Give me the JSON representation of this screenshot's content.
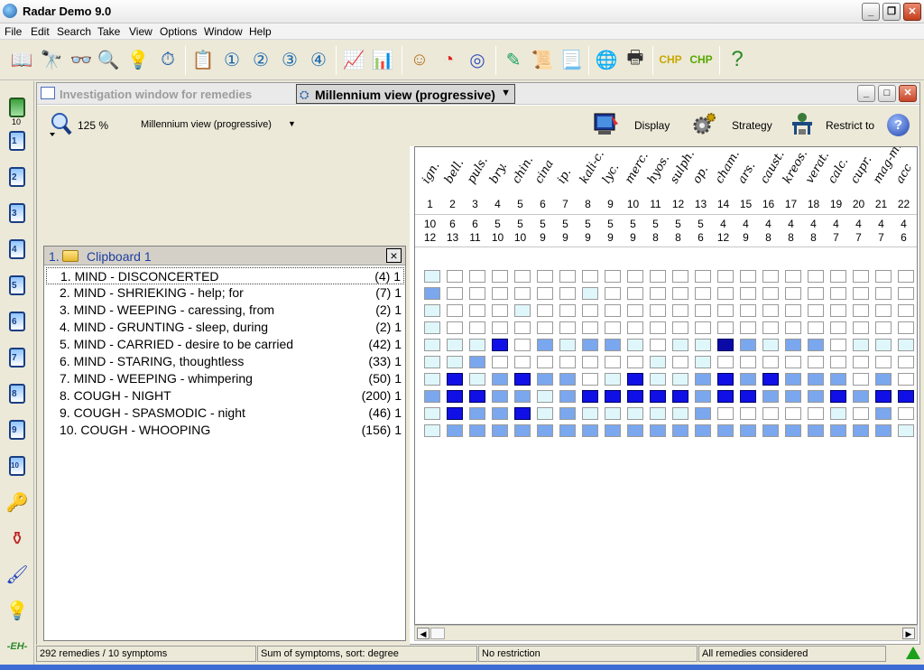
{
  "app": {
    "title": "Radar Demo 9.0"
  },
  "menu": [
    "File",
    "Edit",
    "Search",
    "Take",
    "View",
    "Options",
    "Window",
    "Help"
  ],
  "left_sidebar": {
    "counter": "10",
    "clipboards": [
      "1",
      "2",
      "3",
      "4",
      "5",
      "6",
      "7",
      "8",
      "9",
      "10"
    ]
  },
  "window": {
    "title": "Investigation window for remedies",
    "view_selector": "Millennium view (progressive)",
    "zoom": "125 %",
    "view_name": "Millennium view (progressive)",
    "display_label": "Display",
    "strategy_label": "Strategy",
    "restrict_label": "Restrict to",
    "help_label": "?"
  },
  "clipboard": {
    "number": "1.",
    "title": "Clipboard 1",
    "close": "×",
    "symptoms": [
      {
        "text": "1. MIND - DISCONCERTED",
        "count": "(4) 1"
      },
      {
        "text": "2. MIND - SHRIEKING - help; for",
        "count": "(7) 1"
      },
      {
        "text": "3. MIND - WEEPING - caressing, from",
        "count": "(2) 1"
      },
      {
        "text": "4. MIND - GRUNTING - sleep, during",
        "count": "(2) 1"
      },
      {
        "text": "5. MIND - CARRIED - desire to be carried",
        "count": "(42) 1"
      },
      {
        "text": "6. MIND - STARING, thoughtless",
        "count": "(33) 1"
      },
      {
        "text": "7. MIND - WEEPING - whimpering",
        "count": "(50) 1"
      },
      {
        "text": "8. COUGH - NIGHT",
        "count": "(200) 1"
      },
      {
        "text": "9. COUGH - SPASMODIC - night",
        "count": "(46) 1"
      },
      {
        "text": "10. COUGH - WHOOPING",
        "count": "(156) 1"
      }
    ]
  },
  "remedies": [
    {
      "name": "ign.",
      "num": "1",
      "sum": "10",
      "deg": "12"
    },
    {
      "name": "bell.",
      "num": "2",
      "sum": "6",
      "deg": "13"
    },
    {
      "name": "puls.",
      "num": "3",
      "sum": "6",
      "deg": "11"
    },
    {
      "name": "bry.",
      "num": "4",
      "sum": "5",
      "deg": "10"
    },
    {
      "name": "chin.",
      "num": "5",
      "sum": "5",
      "deg": "10"
    },
    {
      "name": "cina",
      "num": "6",
      "sum": "5",
      "deg": "9"
    },
    {
      "name": "ip.",
      "num": "7",
      "sum": "5",
      "deg": "9"
    },
    {
      "name": "kali-c.",
      "num": "8",
      "sum": "5",
      "deg": "9"
    },
    {
      "name": "lyc.",
      "num": "9",
      "sum": "5",
      "deg": "9"
    },
    {
      "name": "merc.",
      "num": "10",
      "sum": "5",
      "deg": "9"
    },
    {
      "name": "hyos.",
      "num": "11",
      "sum": "5",
      "deg": "8"
    },
    {
      "name": "sulph.",
      "num": "12",
      "sum": "5",
      "deg": "8"
    },
    {
      "name": "op.",
      "num": "13",
      "sum": "5",
      "deg": "6"
    },
    {
      "name": "cham.",
      "num": "14",
      "sum": "4",
      "deg": "12"
    },
    {
      "name": "ars.",
      "num": "15",
      "sum": "4",
      "deg": "9"
    },
    {
      "name": "caust.",
      "num": "16",
      "sum": "4",
      "deg": "8"
    },
    {
      "name": "kreos.",
      "num": "17",
      "sum": "4",
      "deg": "8"
    },
    {
      "name": "verat.",
      "num": "18",
      "sum": "4",
      "deg": "8"
    },
    {
      "name": "calc.",
      "num": "19",
      "sum": "4",
      "deg": "7"
    },
    {
      "name": "cupr.",
      "num": "20",
      "sum": "4",
      "deg": "7"
    },
    {
      "name": "mag-m.",
      "num": "21",
      "sum": "4",
      "deg": "7"
    },
    {
      "name": "acc",
      "num": "22",
      "sum": "4",
      "deg": "6"
    }
  ],
  "grades": [
    [
      1,
      0,
      0,
      0,
      0,
      0,
      0,
      0,
      0,
      0,
      0,
      0,
      0,
      0,
      0,
      0,
      0,
      0,
      0,
      0,
      0,
      0
    ],
    [
      2,
      0,
      0,
      0,
      0,
      0,
      0,
      1,
      0,
      0,
      0,
      0,
      0,
      0,
      0,
      0,
      0,
      0,
      0,
      0,
      0,
      0
    ],
    [
      1,
      0,
      0,
      0,
      1,
      0,
      0,
      0,
      0,
      0,
      0,
      0,
      0,
      0,
      0,
      0,
      0,
      0,
      0,
      0,
      0,
      0
    ],
    [
      1,
      0,
      0,
      0,
      0,
      0,
      0,
      0,
      0,
      0,
      0,
      0,
      0,
      0,
      0,
      0,
      0,
      0,
      0,
      0,
      0,
      0
    ],
    [
      1,
      1,
      1,
      3,
      0,
      2,
      1,
      2,
      2,
      1,
      0,
      1,
      1,
      4,
      2,
      1,
      2,
      2,
      0,
      1,
      1,
      1
    ],
    [
      1,
      1,
      2,
      0,
      0,
      0,
      0,
      0,
      0,
      0,
      1,
      0,
      1,
      0,
      0,
      0,
      0,
      0,
      0,
      0,
      0,
      0
    ],
    [
      1,
      3,
      1,
      2,
      3,
      2,
      2,
      0,
      1,
      3,
      1,
      1,
      2,
      3,
      2,
      3,
      2,
      2,
      2,
      0,
      2,
      0
    ],
    [
      2,
      3,
      3,
      2,
      2,
      1,
      2,
      3,
      3,
      3,
      3,
      3,
      2,
      3,
      3,
      2,
      2,
      2,
      3,
      2,
      3,
      3
    ],
    [
      1,
      3,
      2,
      2,
      3,
      1,
      2,
      1,
      1,
      1,
      1,
      1,
      2,
      0,
      0,
      0,
      0,
      0,
      1,
      0,
      2,
      0
    ],
    [
      1,
      2,
      2,
      2,
      2,
      2,
      2,
      2,
      2,
      2,
      2,
      2,
      2,
      2,
      2,
      2,
      2,
      2,
      2,
      2,
      2,
      1
    ]
  ],
  "colors": {
    "g0": "#ffffff",
    "g1": "#dff7fb",
    "g2": "#7aa7ee",
    "g3": "#1010e6",
    "g4": "#0a0aa6"
  },
  "status": {
    "remedies": "292 remedies / 10 symptoms",
    "sort": "Sum of symptoms, sort: degree",
    "restriction": "No restriction",
    "considered": "All remedies considered"
  }
}
